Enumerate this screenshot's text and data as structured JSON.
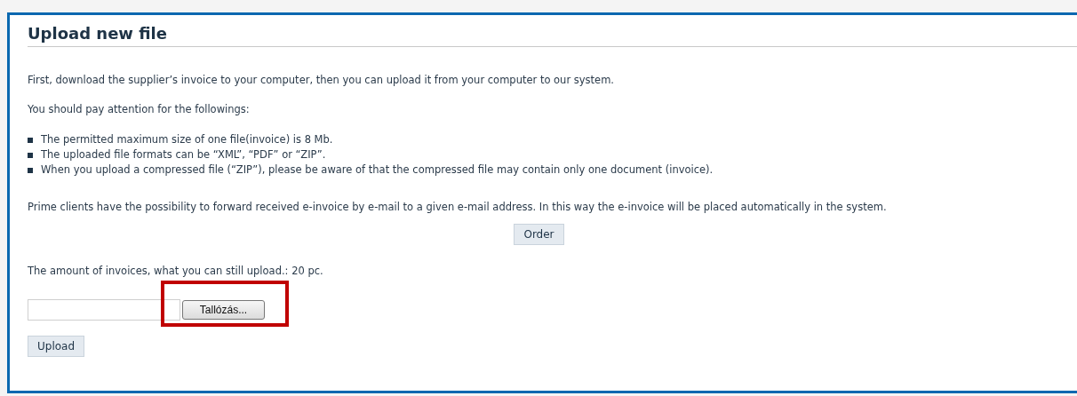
{
  "title": "Upload new file",
  "intro": "First, download the supplier’s invoice to your computer, then you can upload it from your computer to our system.",
  "attention": "You should pay attention for the followings:",
  "rules": [
    "The permitted maximum size of one file(invoice) is 8 Mb.",
    "The uploaded file formats can be “XML”, “PDF” or “ZIP”.",
    "When you upload a compressed file (“ZIP”), please be aware of that the compressed file may contain only one document (invoice)."
  ],
  "prime_note": "Prime clients have the possibility to forward received e-invoice by e-mail to a given e-mail address. In this way the e-invoice will be placed automatically in the system.",
  "order_button": "Order",
  "remaining": "The amount of invoices, what you can still upload.: 20 pc.",
  "file_picker": {
    "browse_button": "Tallózás...",
    "highlighted": true
  },
  "upload_button": "Upload"
}
